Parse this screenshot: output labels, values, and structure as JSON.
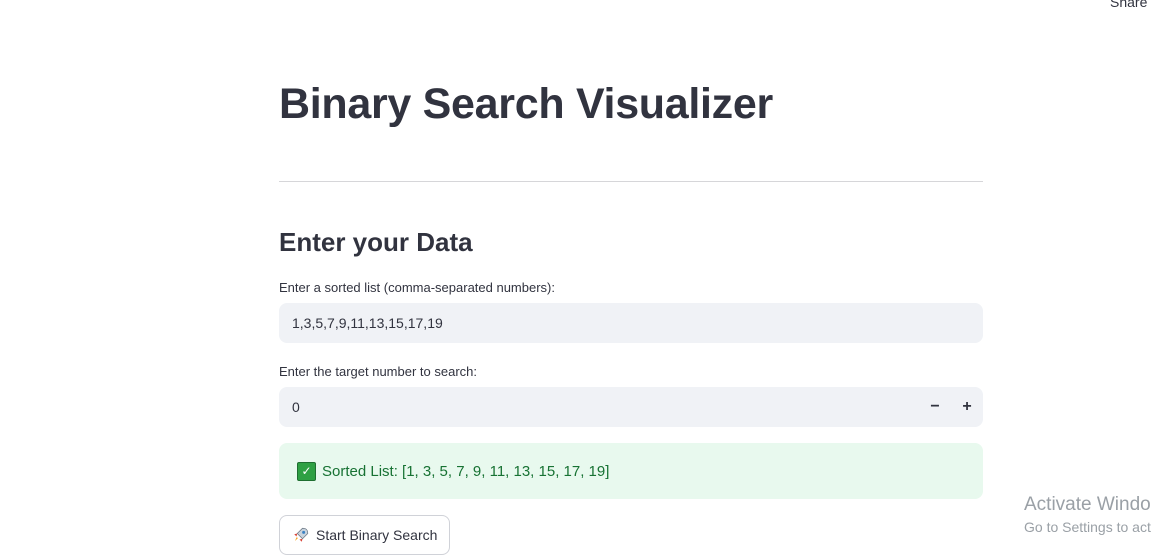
{
  "header": {
    "share_label": "Share"
  },
  "main": {
    "title": "Binary Search Visualizer",
    "section_heading": "Enter your Data",
    "list_field": {
      "label": "Enter a sorted list (comma-separated numbers):",
      "value": "1,3,5,7,9,11,13,15,17,19"
    },
    "target_field": {
      "label": "Enter the target number to search:",
      "value": "0",
      "decrement_label": "−",
      "increment_label": "+"
    },
    "success_message": {
      "text": "Sorted List: [1, 3, 5, 7, 9, 11, 13, 15, 17, 19]",
      "icon": "check-icon"
    },
    "start_button": {
      "label": "Start Binary Search",
      "icon": "rocket-icon"
    }
  },
  "watermark": {
    "line1": "Activate Windo",
    "line2": "Go to Settings to act"
  },
  "colors": {
    "text": "#31333f",
    "input_bg": "#f0f2f6",
    "success_bg": "#e8f9ee",
    "success_text": "#177233"
  }
}
